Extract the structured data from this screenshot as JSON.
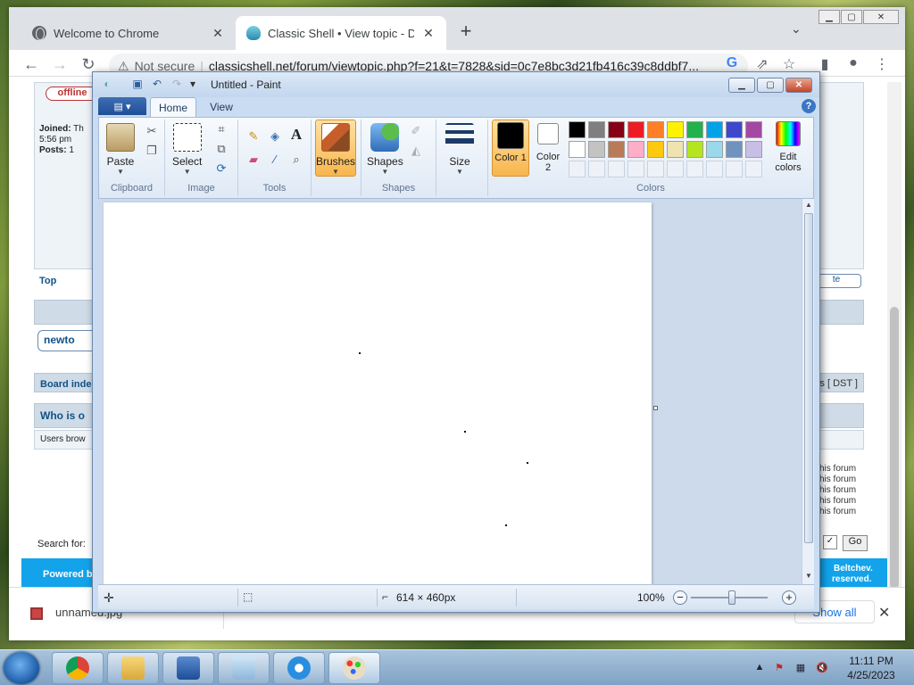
{
  "chrome": {
    "tabs": [
      {
        "title": "Welcome to Chrome",
        "icon": "globe-icon",
        "active": false
      },
      {
        "title": "Classic Shell • View topic - Diamond",
        "icon": "classic-shell-icon",
        "active": true
      }
    ],
    "new_tab": "+",
    "security_label": "Not secure",
    "url": "classicshell.net/forum/viewtopic.php?f=21&t=7828&sid=0c7e8bc3d21fb416c39c8ddbf7...",
    "download": {
      "file_name": "unnamed.jpg",
      "show_all": "Show all"
    }
  },
  "forum": {
    "offline": "offline",
    "joined_label": "Joined:",
    "joined_value": "Th",
    "joined_time": "5:56 pm",
    "posts_label": "Posts:",
    "posts_value": "1",
    "top": "Top",
    "quote_btn": "te",
    "new_topic": "newto",
    "board_index": "Board inde",
    "dst": "s [ DST ]",
    "who_is": "Who is o",
    "users_brow": "Users brow",
    "forum_perms": [
      "his forum",
      "his forum",
      "his forum",
      "his forum",
      "his forum"
    ],
    "search_for": "Search for:",
    "go": "Go",
    "powered_by": "Powered by p",
    "footer_right_1": "Beltchev.",
    "footer_right_2": "reserved."
  },
  "paint": {
    "title": "Untitled - Paint",
    "ribbon_tabs": [
      "Home",
      "View"
    ],
    "groups": {
      "clipboard": "Clipboard",
      "image": "Image",
      "tools": "Tools",
      "shapes": "Shapes",
      "colors": "Colors"
    },
    "buttons": {
      "paste": "Paste",
      "select": "Select",
      "brushes": "Brushes",
      "shapes": "Shapes",
      "size": "Size",
      "color1": "Color 1",
      "color2": "Color 2",
      "edit_colors": "Edit colors"
    },
    "palette_row1": [
      "#000000",
      "#7f7f7f",
      "#880015",
      "#ed1c24",
      "#ff7f27",
      "#fff200",
      "#22b14c",
      "#00a2e8",
      "#3f48cc",
      "#a349a4"
    ],
    "palette_row2": [
      "#ffffff",
      "#c3c3c3",
      "#b97a57",
      "#ffaec9",
      "#ffc90e",
      "#efe4b0",
      "#b5e61d",
      "#99d9ea",
      "#7092be",
      "#c8bfe7"
    ],
    "color1_value": "#000000",
    "color2_value": "#ffffff",
    "status": {
      "dimensions": "614 × 460px",
      "zoom": "100%"
    }
  },
  "taskbar": {
    "time": "11:11 PM",
    "date": "4/25/2023",
    "apps": [
      "chrome-icon",
      "windows-explorer-icon",
      "remote-desktop-icon",
      "notepad-icon",
      "internet-explorer-icon",
      "paint-icon"
    ]
  }
}
